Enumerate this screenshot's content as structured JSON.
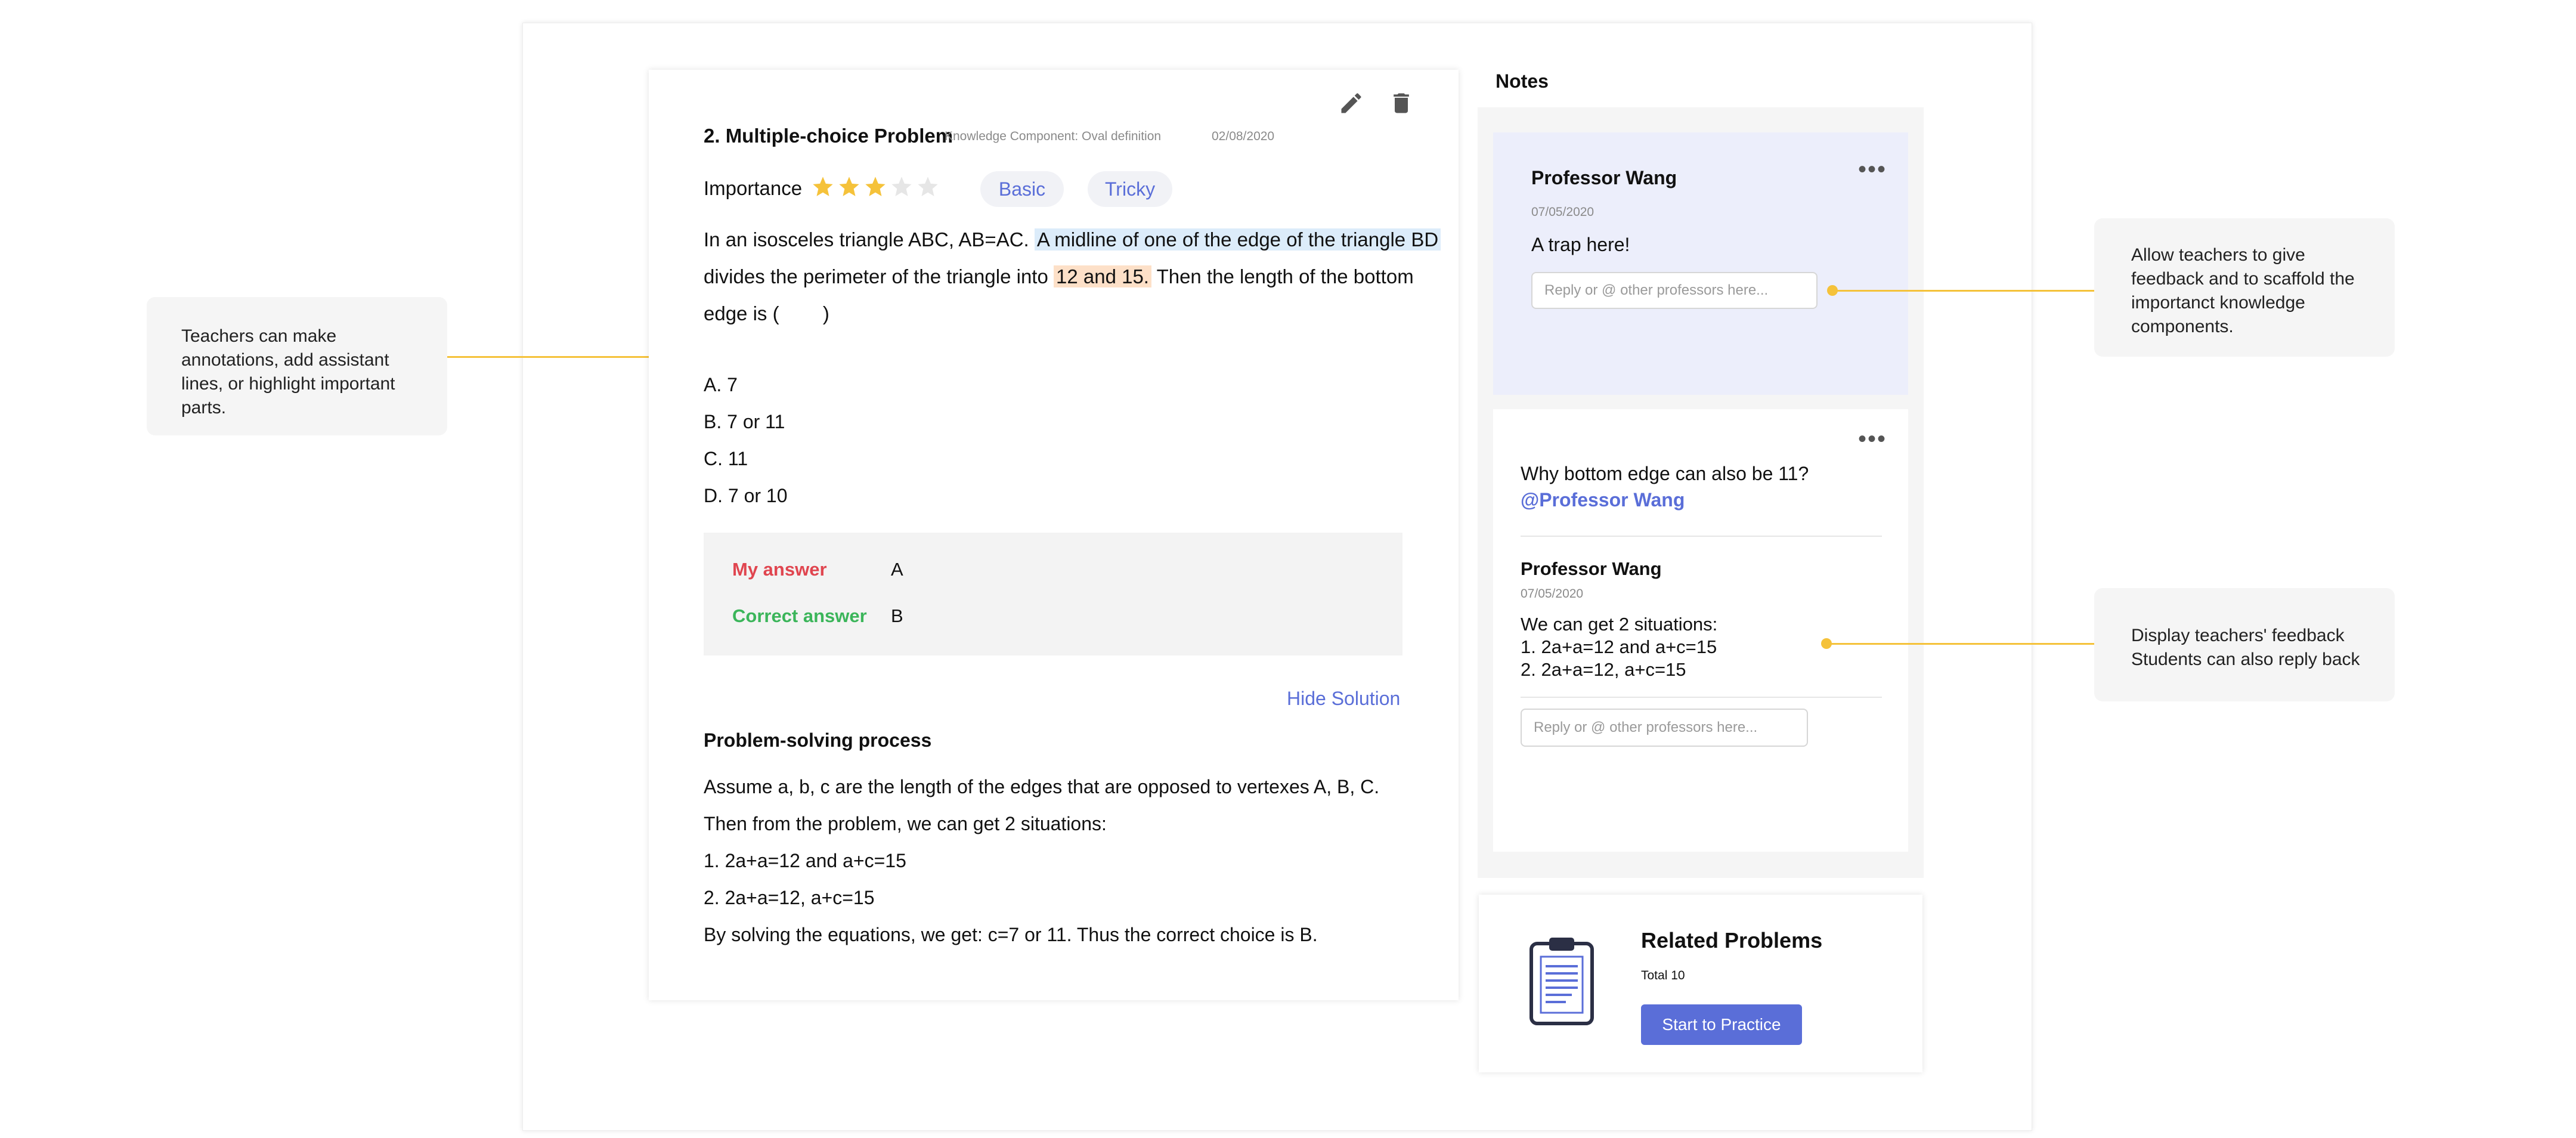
{
  "question": {
    "title": "2. Multiple-choice Problem",
    "kc": "Knowledge Component: Oval definition",
    "date": "02/08/2020",
    "importance_label": "Importance",
    "importance_rating": 3,
    "importance_max": 5,
    "tags": [
      "Basic",
      "Tricky"
    ],
    "stem_line1_plain": "In an isosceles triangle ABC, AB=AC.",
    "stem_line1_hl": "A midline of one of the edge of the triangle BD",
    "stem_line2_plain": "divides the perimeter of the triangle into",
    "stem_line2_hl": "12 and 15.",
    "stem_line2_tail": "Then the length of the bottom",
    "stem_line3": "edge is (        )",
    "options": [
      "A. 7",
      "B. 7 or 11",
      "C. 11",
      "D. 7 or 10"
    ],
    "my_answer_label": "My answer",
    "my_answer_value": "A",
    "correct_answer_label": "Correct answer",
    "correct_answer_value": "B",
    "hide_solution": "Hide Solution",
    "process_title": "Problem-solving process",
    "process_lines": [
      "Assume a, b, c are the length of the edges that are opposed to vertexes A, B, C.",
      "Then from the problem, we can get 2 situations:",
      "1. 2a+a=12 and a+c=15",
      "2. 2a+a=12, a+c=15",
      "By solving the equations, we get: c=7 or 11. Thus the correct choice is B."
    ]
  },
  "notes": {
    "title": "Notes",
    "note1": {
      "author": "Professor Wang",
      "date": "07/05/2020",
      "text": "A trap here!",
      "reply_placeholder": "Reply or @ other professors here..."
    },
    "note2": {
      "question": "Why bottom edge can also be 11?",
      "mention": "@Professor Wang",
      "author": "Professor Wang",
      "date": "07/05/2020",
      "answer_lines": [
        "We can get 2 situations:",
        "1. 2a+a=12 and a+c=15",
        "2. 2a+a=12, a+c=15"
      ],
      "reply_placeholder": "Reply or @ other professors here..."
    }
  },
  "related": {
    "title": "Related Problems",
    "total": "Total 10",
    "button": "Start to Practice"
  },
  "callouts": {
    "left": "Teachers can make annotations, add assistant lines, or highlight important parts.",
    "right_top": "Allow teachers to give feedback and to scaffold the importanct knowledge components.",
    "right_bottom_1": "Display teachers' feedback",
    "right_bottom_2": "Students can also reply back"
  },
  "colors": {
    "accent": "#5a6ed8",
    "star": "#f5c23a",
    "wrong": "#e0454f",
    "right": "#3bb55a",
    "highlight_blue": "#dcecfa",
    "highlight_orange": "#fde0c8",
    "note_bg": "#eceefb"
  },
  "icons": [
    "edit-icon",
    "trash-icon",
    "more-icon",
    "clipboard-icon",
    "star-icon"
  ]
}
